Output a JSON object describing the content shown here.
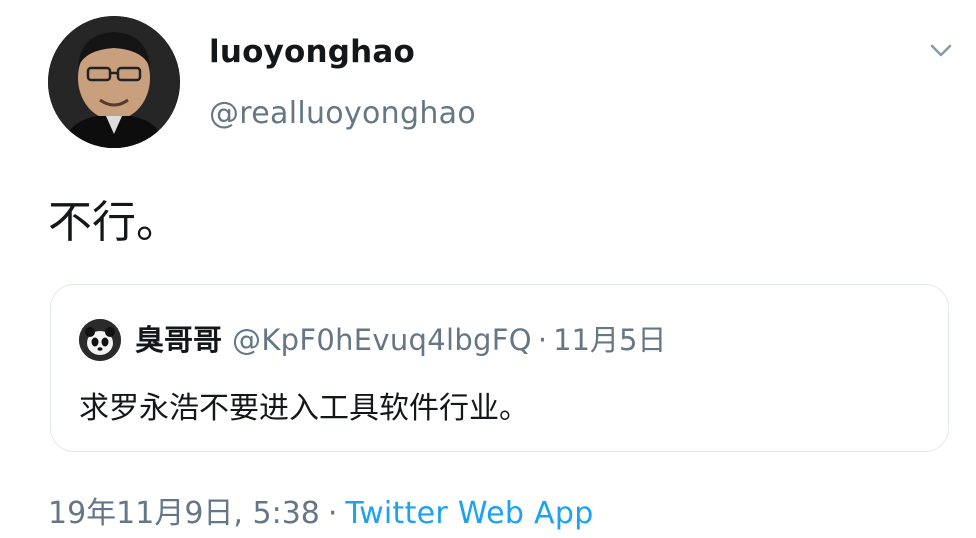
{
  "author": {
    "display_name": "luoyonghao",
    "handle": "@realluoyonghao",
    "avatar_icon": "profile-photo"
  },
  "tweet": {
    "text": "不行。"
  },
  "quoted_tweet": {
    "display_name": "臭哥哥",
    "handle": "@KpF0hEvuq4lbgFQ",
    "separator": "·",
    "date": "11月5日",
    "text": "求罗永浩不要进入工具软件行业。",
    "avatar_icon": "panda-avatar"
  },
  "meta": {
    "timestamp": "19年11月9日, 5:38",
    "separator": "·",
    "source": "Twitter Web App"
  },
  "menu": {
    "icon": "chevron-down-icon"
  },
  "colors": {
    "text_primary": "#14171a",
    "text_secondary": "#657786",
    "link": "#1da1f2",
    "border": "#e1e8ed"
  }
}
